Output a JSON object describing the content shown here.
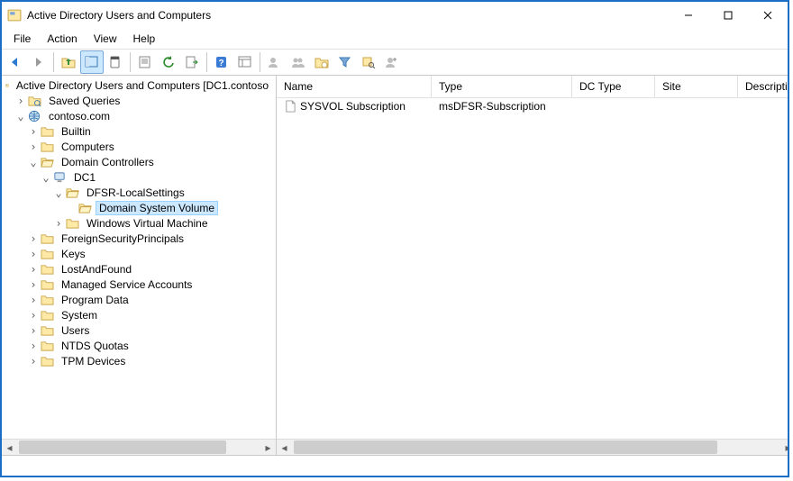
{
  "window": {
    "title": "Active Directory Users and Computers"
  },
  "menu": {
    "file": "File",
    "action": "Action",
    "view": "View",
    "help": "Help"
  },
  "tree": {
    "root": "Active Directory Users and Computers [DC1.contoso",
    "saved_queries": "Saved Queries",
    "domain": "contoso.com",
    "builtin": "Builtin",
    "computers": "Computers",
    "domain_controllers": "Domain Controllers",
    "dc1": "DC1",
    "dfsr": "DFSR-LocalSettings",
    "dsv": "Domain System Volume",
    "wvm": "Windows Virtual Machine",
    "fsp": "ForeignSecurityPrincipals",
    "keys": "Keys",
    "laf": "LostAndFound",
    "msa": "Managed Service Accounts",
    "pdata": "Program Data",
    "system": "System",
    "users": "Users",
    "ntds": "NTDS Quotas",
    "tpm": "TPM Devices"
  },
  "columns": {
    "name": "Name",
    "type": "Type",
    "dc_type": "DC Type",
    "site": "Site",
    "description": "Description"
  },
  "rows": [
    {
      "name": "SYSVOL Subscription",
      "type": "msDFSR-Subscription",
      "dc_type": "",
      "site": "",
      "description": ""
    }
  ],
  "col_widths": {
    "name": 172,
    "type": 156,
    "dc_type": 92,
    "site": 92,
    "description": 64
  }
}
